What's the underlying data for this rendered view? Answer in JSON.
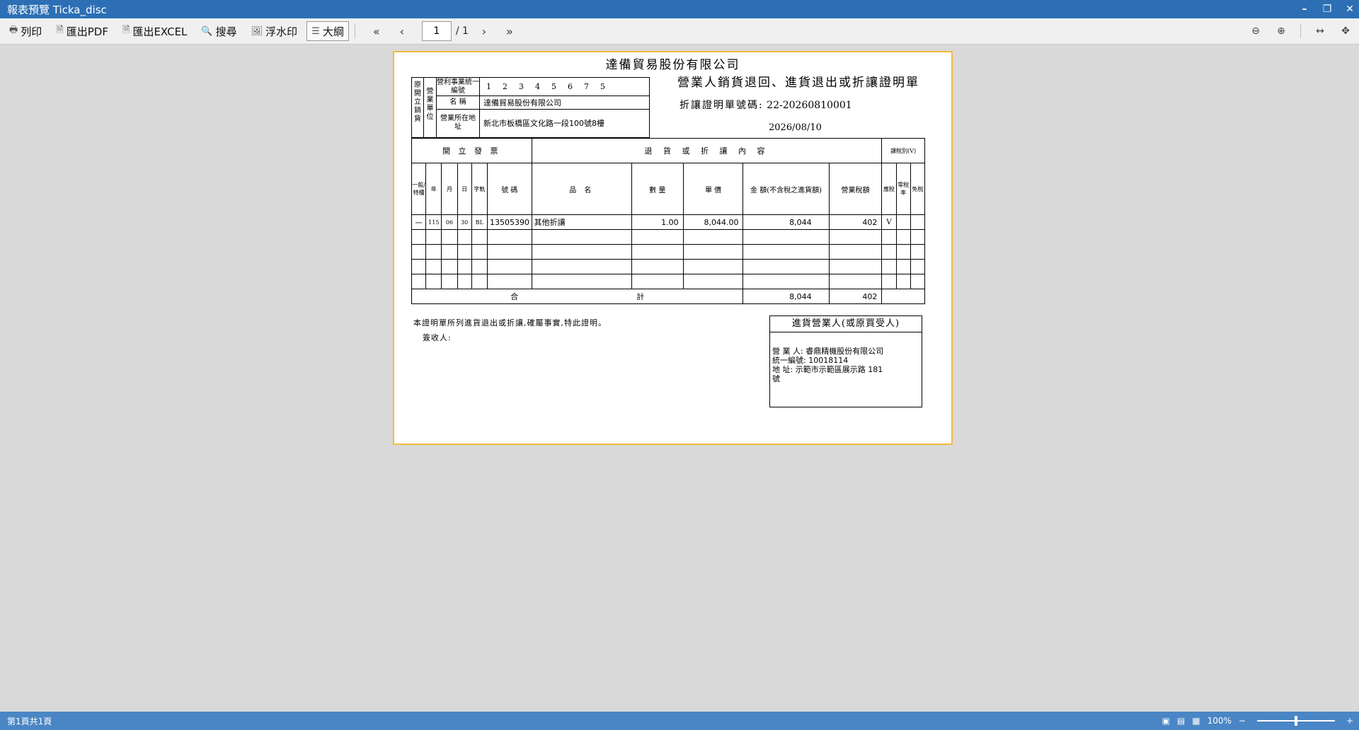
{
  "window": {
    "title": "報表預覽 Ticka_disc",
    "minimize": "–",
    "restore": "❐",
    "close": "✕"
  },
  "toolbar": {
    "buttons": [
      {
        "icon": "🖶",
        "label": "列印"
      },
      {
        "icon": "🗎",
        "label": "匯出PDF"
      },
      {
        "icon": "🗎",
        "label": "匯出EXCEL"
      },
      {
        "icon": "🔍",
        "label": "搜尋"
      },
      {
        "icon": "🖼",
        "label": "浮水印"
      },
      {
        "icon": "☰",
        "label": "大綱"
      }
    ],
    "nav": {
      "first": "«",
      "prev": "‹",
      "next": "›",
      "last": "»"
    },
    "page_value": "1",
    "page_total": "/ 1",
    "right": {
      "zoom_out": "⊖",
      "zoom_in": "⊕",
      "fit_width": "↔",
      "fit_page": "✥"
    }
  },
  "report": {
    "company": "達備貿易股份有限公司",
    "title": "營業人銷貨退回、進貨退出或折讓證明單",
    "disc_label": "折讓證明單號碼:",
    "disc_no": "22-20260810001",
    "date": "2026/08/10",
    "seller": {
      "c1": "原開立銷貨",
      "c2": "營業單位",
      "tax_label": "營利事業統一編號",
      "tax_digits": [
        "1",
        "2",
        "3",
        "4",
        "5",
        "6",
        "7",
        "5"
      ],
      "name_label": "名 稱",
      "name": "達備貿易股份有限公司",
      "addr_label": "營業所在地 址",
      "addr": "新北市板橋區文化路一段100號8樓"
    },
    "table": {
      "h_invoice": "開 立 發 票",
      "h_content": "退 貨 或 折 讓 內 容",
      "h_tax_type": "課稅別(V)",
      "cols": {
        "kind": "一般/特種",
        "year": "年",
        "month": "月",
        "day": "日",
        "track": "字軌",
        "number": "號 碼",
        "item": "品 名",
        "qty": "數 量",
        "price": "單 價",
        "amount": "金 額(不含稅之進貨額)",
        "tax": "營業稅額",
        "taxable": "應稅",
        "zero": "零稅率",
        "exempt": "免稅"
      },
      "rows": [
        {
          "kind": "一",
          "year": "115",
          "month": "06",
          "day": "30",
          "track": "BL",
          "number": "13505390",
          "item": "其他折讓",
          "qty": "1.00",
          "price": "8,044.00",
          "amount": "8,044",
          "tax": "402",
          "taxable": "V",
          "zero": "",
          "exempt": ""
        }
      ],
      "total_label_1": "合",
      "total_label_2": "計",
      "total_amount": "8,044",
      "total_tax": "402"
    },
    "note": "本證明單所列進貨退出或折讓,確屬事實,特此證明。",
    "signer_label": "簽收人:",
    "buyer": {
      "header": "進貨營業人(或原買受人)",
      "name_line": "營 業 人: 睿鼎精機股份有限公司",
      "tax_line": "統一編號: 10018114",
      "addr_line": "地 址: 示範市示範區展示路 181",
      "addr_line2": "號"
    }
  },
  "status": {
    "info": "第1頁共1頁",
    "zoom": "100%",
    "minus": "−",
    "plus": "+",
    "zoom_level": 0.5
  }
}
